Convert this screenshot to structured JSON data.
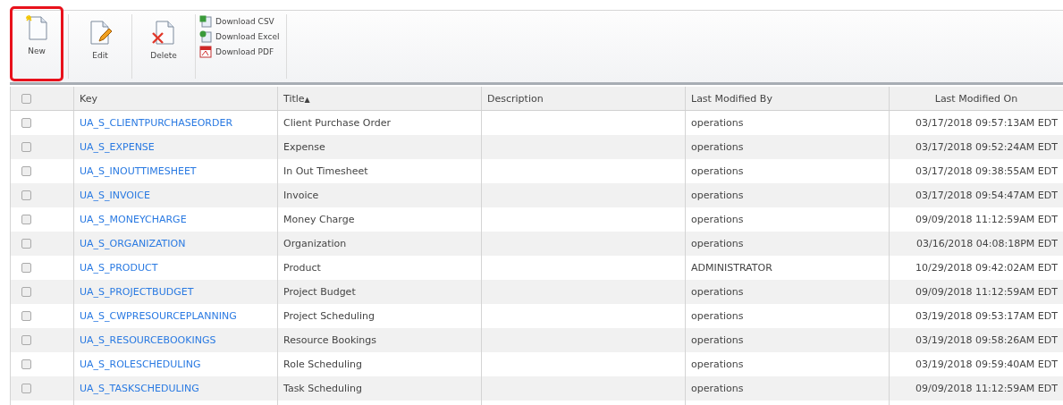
{
  "toolbar": {
    "buttons": [
      {
        "kind": "new",
        "label": "New",
        "highlighted": true
      },
      {
        "kind": "edit",
        "label": "Edit",
        "highlighted": false
      },
      {
        "kind": "delete",
        "label": "Delete",
        "highlighted": false
      }
    ],
    "downloads": [
      {
        "kind": "csv",
        "label": "Download CSV"
      },
      {
        "kind": "excel",
        "label": "Download Excel"
      },
      {
        "kind": "pdf",
        "label": "Download PDF"
      }
    ]
  },
  "table": {
    "select_all_checked": false,
    "columns": [
      {
        "label": "Key"
      },
      {
        "label": "Title",
        "sort_indicator": "▲"
      },
      {
        "label": "Description"
      },
      {
        "label": "Last Modified By"
      },
      {
        "label": "Last Modified On"
      }
    ],
    "rows": [
      {
        "checked": false,
        "key": "UA_S_CLIENTPURCHASEORDER",
        "title": "Client Purchase Order",
        "modified_by": "operations",
        "modified_on": "03/17/2018 09:57:13AM EDT"
      },
      {
        "checked": false,
        "key": "UA_S_EXPENSE",
        "title": "Expense",
        "modified_by": "operations",
        "modified_on": "03/17/2018 09:52:24AM EDT"
      },
      {
        "checked": false,
        "key": "UA_S_INOUTTIMESHEET",
        "title": "In Out Timesheet",
        "modified_by": "operations",
        "modified_on": "03/17/2018 09:38:55AM EDT"
      },
      {
        "checked": false,
        "key": "UA_S_INVOICE",
        "title": "Invoice",
        "modified_by": "operations",
        "modified_on": "03/17/2018 09:54:47AM EDT"
      },
      {
        "checked": false,
        "key": "UA_S_MONEYCHARGE",
        "title": "Money Charge",
        "modified_by": "operations",
        "modified_on": "09/09/2018 11:12:59AM EDT"
      },
      {
        "checked": false,
        "key": "UA_S_ORGANIZATION",
        "title": "Organization",
        "modified_by": "operations",
        "modified_on": "03/16/2018 04:08:18PM EDT"
      },
      {
        "checked": false,
        "key": "UA_S_PRODUCT",
        "title": "Product",
        "modified_by": "ADMINISTRATOR",
        "modified_on": "10/29/2018 09:42:02AM EDT"
      },
      {
        "checked": false,
        "key": "UA_S_PROJECTBUDGET",
        "title": "Project Budget",
        "modified_by": "operations",
        "modified_on": "09/09/2018 11:12:59AM EDT"
      },
      {
        "checked": false,
        "key": "UA_S_CWPRESOURCEPLANNING",
        "title": "Project Scheduling",
        "modified_by": "operations",
        "modified_on": "03/19/2018 09:53:17AM EDT"
      },
      {
        "checked": false,
        "key": "UA_S_RESOURCEBOOKINGS",
        "title": "Resource Bookings",
        "modified_by": "operations",
        "modified_on": "03/19/2018 09:58:26AM EDT"
      },
      {
        "checked": false,
        "key": "UA_S_ROLESCHEDULING",
        "title": "Role Scheduling",
        "modified_by": "operations",
        "modified_on": "03/19/2018 09:59:40AM EDT"
      },
      {
        "checked": false,
        "key": "UA_S_TASKSCHEDULING",
        "title": "Task Scheduling",
        "modified_by": "operations",
        "modified_on": "09/09/2018 11:12:59AM EDT"
      }
    ]
  }
}
